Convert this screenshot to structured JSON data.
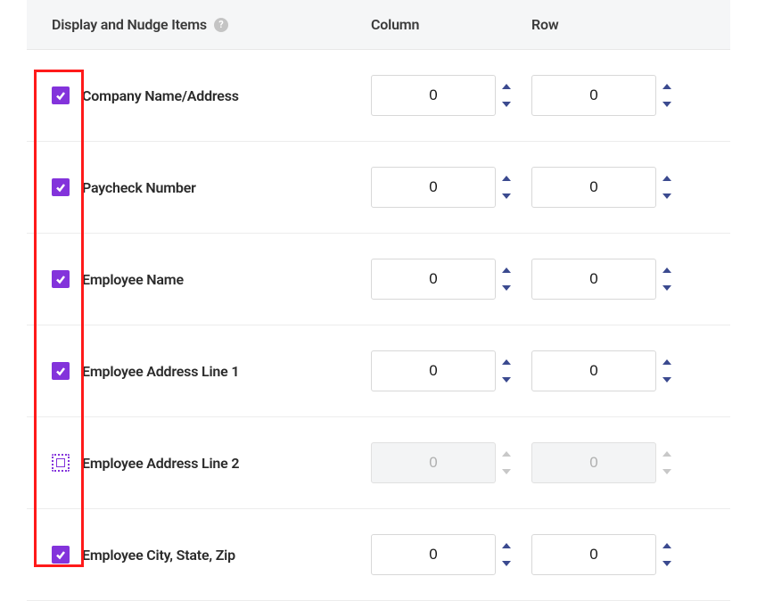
{
  "header": {
    "label": "Display and Nudge Items",
    "column": "Column",
    "row": "Row"
  },
  "rows": [
    {
      "label": "Company Name/Address",
      "checked": true,
      "column": "0",
      "row": "0"
    },
    {
      "label": "Paycheck Number",
      "checked": true,
      "column": "0",
      "row": "0"
    },
    {
      "label": "Employee Name",
      "checked": true,
      "column": "0",
      "row": "0"
    },
    {
      "label": "Employee Address Line 1",
      "checked": true,
      "column": "0",
      "row": "0"
    },
    {
      "label": "Employee Address Line 2",
      "checked": false,
      "column": "0",
      "row": "0"
    },
    {
      "label": "Employee City, State, Zip",
      "checked": true,
      "column": "0",
      "row": "0"
    }
  ]
}
